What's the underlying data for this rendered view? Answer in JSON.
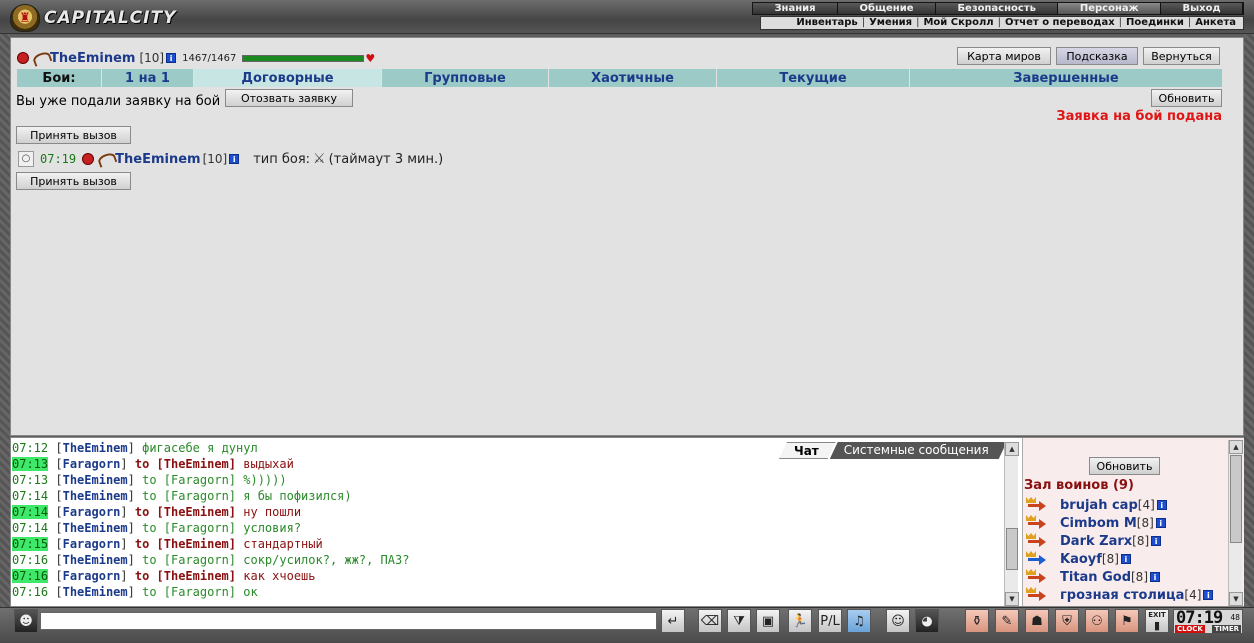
{
  "header": {
    "logo_text": "CAPITALCITY",
    "top_menu": [
      "Знания",
      "Общение",
      "Безопасность",
      "Персонаж",
      "Выход"
    ],
    "sub_menu": [
      "Инвентарь",
      "Умения",
      "Мой Скролл",
      "Отчет о переводах",
      "Поединки",
      "Анкета"
    ]
  },
  "player": {
    "nick": "TheEminem",
    "level": "[10]",
    "hp_text": "1467/1467",
    "hp_fraction": 1.0
  },
  "top_buttons": {
    "world_map": "Карта миров",
    "hint": "Подсказка",
    "back": "Вернуться"
  },
  "tabs": {
    "label": "Бои:",
    "items": [
      "1 на 1",
      "Договорные",
      "Групповые",
      "Хаотичные",
      "Текущие",
      "Завершенные"
    ]
  },
  "request": {
    "text": "Вы уже подали заявку на бой",
    "withdraw": "Отозвать заявку",
    "refresh": "Обновить",
    "status": "Заявка на бой подана",
    "accept": "Принять вызов"
  },
  "challenge": {
    "time": "07:19",
    "nick": "TheEminem",
    "level": "[10]",
    "type_label": "тип боя:",
    "timeout": "(таймаут 3 мин.)",
    "accept": "Принять вызов"
  },
  "chat": {
    "tabs": [
      "Чат",
      "Системные сообщения"
    ],
    "lines": [
      {
        "time": "07:12",
        "hl": false,
        "from": "TheEminem",
        "to": "",
        "priv": false,
        "msg": "фигасебе я дунул"
      },
      {
        "time": "07:13",
        "hl": true,
        "from": "Faragorn",
        "to": "to [TheEminem]",
        "priv": true,
        "msg": "выдыхай"
      },
      {
        "time": "07:13",
        "hl": false,
        "from": "TheEminem",
        "to": "to [Faragorn]",
        "priv": false,
        "msg": "%)))))"
      },
      {
        "time": "07:14",
        "hl": false,
        "from": "TheEminem",
        "to": "to [Faragorn]",
        "priv": false,
        "msg": "я бы пофизился)"
      },
      {
        "time": "07:14",
        "hl": true,
        "from": "Faragorn",
        "to": "to [TheEminem]",
        "priv": true,
        "msg": "ну пошли"
      },
      {
        "time": "07:14",
        "hl": false,
        "from": "TheEminem",
        "to": "to [Faragorn]",
        "priv": false,
        "msg": "условия?"
      },
      {
        "time": "07:15",
        "hl": true,
        "from": "Faragorn",
        "to": "to [TheEminem]",
        "priv": true,
        "msg": "стандартный"
      },
      {
        "time": "07:16",
        "hl": false,
        "from": "TheEminem",
        "to": "to [Faragorn]",
        "priv": false,
        "msg": "сокр/усилок?, жж?, ПАЗ?"
      },
      {
        "time": "07:16",
        "hl": true,
        "from": "Faragorn",
        "to": "to [TheEminem]",
        "priv": true,
        "msg": "как хчоешь"
      },
      {
        "time": "07:16",
        "hl": false,
        "from": "TheEminem",
        "to": "to [Faragorn]",
        "priv": false,
        "msg": "ок"
      }
    ]
  },
  "users": {
    "refresh": "Обновить",
    "title": "Зал воинов (9)",
    "list": [
      {
        "name": "brujah cap",
        "level": "[4]",
        "icon": "attack-icon"
      },
      {
        "name": "Cimbom M",
        "level": "[8]",
        "icon": "attack-icon"
      },
      {
        "name": "Dark Zarx",
        "level": "[8]",
        "icon": "attack-icon"
      },
      {
        "name": "Kaoyf",
        "level": "[8]",
        "icon": "clan-attack-icon"
      },
      {
        "name": "Titan God",
        "level": "[8]",
        "icon": "attack-icon"
      },
      {
        "name": "грозная столица",
        "level": "[4]",
        "icon": "attack-icon"
      }
    ]
  },
  "clock": {
    "time": "07:19",
    "seconds": "48",
    "label_clock": "CLOCK",
    "label_timer": "TIMER"
  },
  "toolbar": {
    "exit_label": "EXIT"
  }
}
